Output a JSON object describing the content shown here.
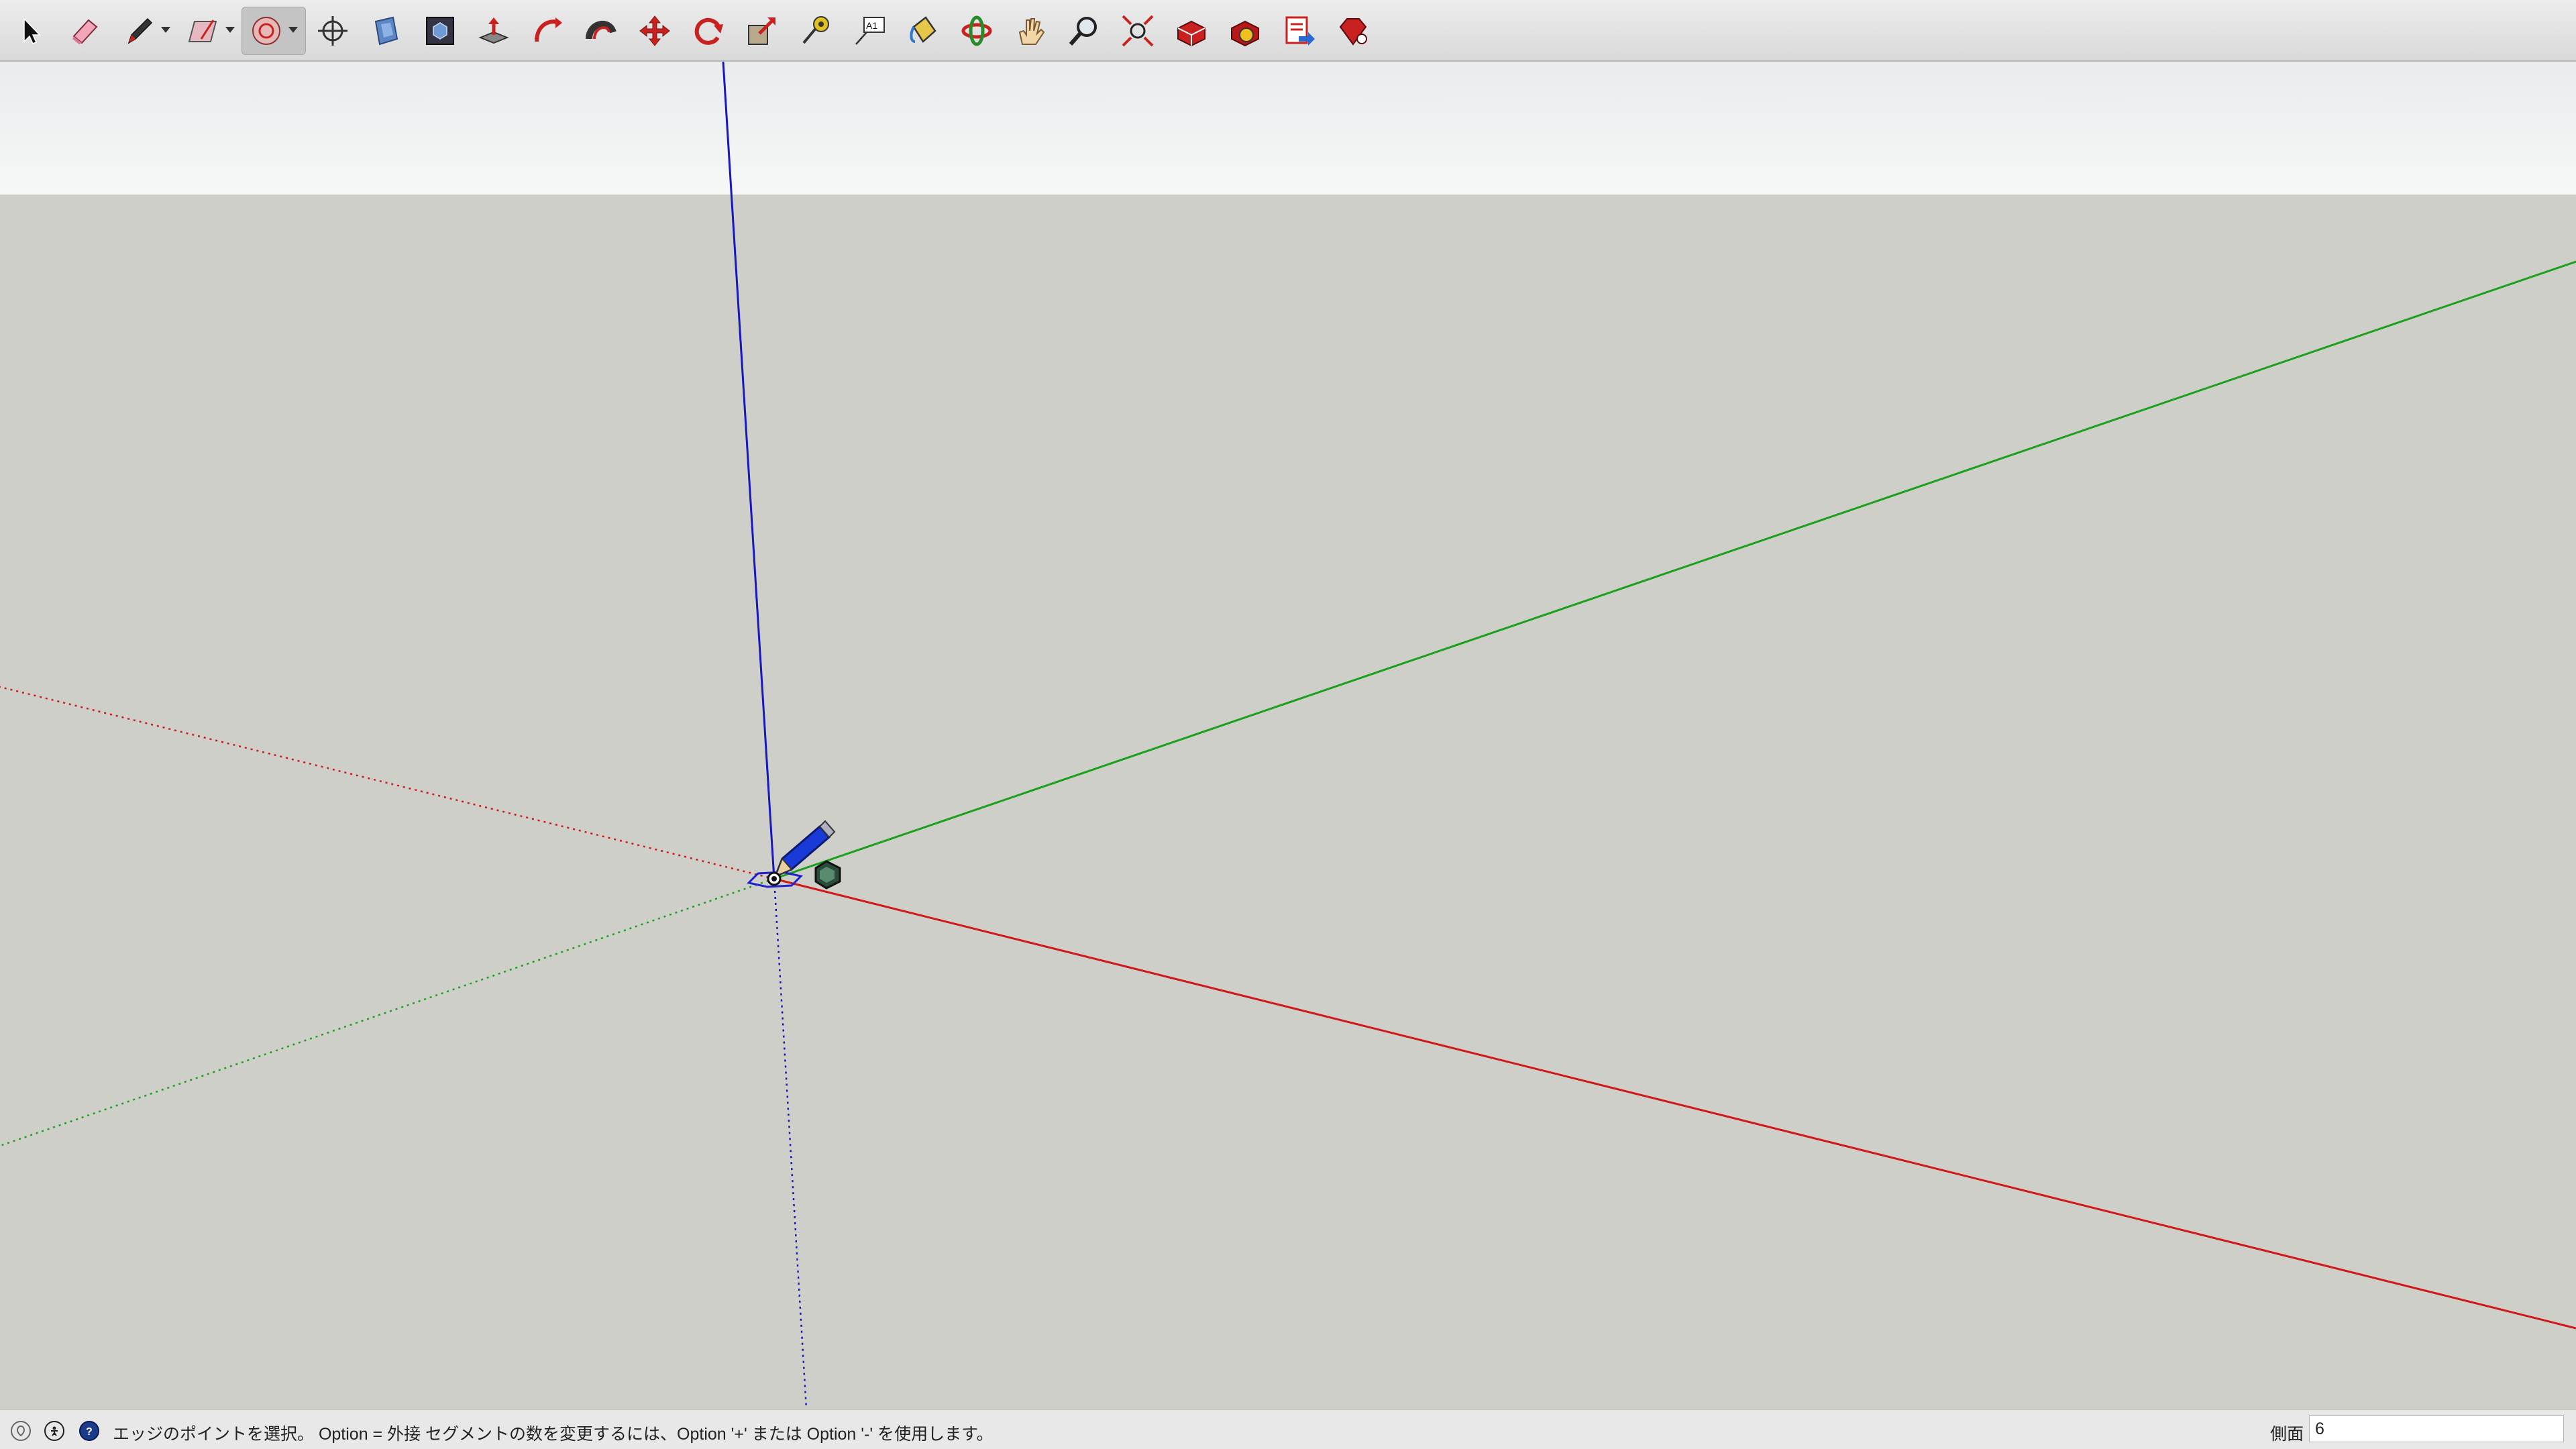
{
  "toolbar": {
    "tools": [
      {
        "name": "select-tool",
        "icon": "arrow-cursor-icon"
      },
      {
        "name": "eraser-tool",
        "icon": "eraser-icon"
      },
      {
        "name": "line-tool",
        "icon": "pencil-icon",
        "has_dropdown": true
      },
      {
        "name": "rectangle-tool",
        "icon": "rectangle-icon",
        "has_dropdown": true
      },
      {
        "name": "polygon-tool",
        "icon": "polygon-icon",
        "has_dropdown": true,
        "active": true
      },
      {
        "name": "orbit-center-tool",
        "icon": "crosshair-icon"
      },
      {
        "name": "component-tool",
        "icon": "component-icon"
      },
      {
        "name": "group-tool",
        "icon": "group-icon"
      },
      {
        "name": "push-pull-tool",
        "icon": "push-pull-icon"
      },
      {
        "name": "follow-me-tool",
        "icon": "follow-me-icon"
      },
      {
        "name": "offset-tool",
        "icon": "offset-icon"
      },
      {
        "name": "move-tool",
        "icon": "move-icon"
      },
      {
        "name": "rotate-tool",
        "icon": "rotate-icon"
      },
      {
        "name": "scale-tool",
        "icon": "scale-icon"
      },
      {
        "name": "tape-measure-tool",
        "icon": "tape-measure-icon"
      },
      {
        "name": "text-tool",
        "icon": "text-label-icon"
      },
      {
        "name": "paint-bucket-tool",
        "icon": "paint-bucket-icon"
      },
      {
        "name": "orbit-tool",
        "icon": "orbit-icon"
      },
      {
        "name": "pan-tool",
        "icon": "hand-icon"
      },
      {
        "name": "zoom-tool",
        "icon": "magnifier-icon"
      },
      {
        "name": "zoom-extents-tool",
        "icon": "zoom-extents-icon"
      },
      {
        "name": "warehouse-tool",
        "icon": "warehouse-icon"
      },
      {
        "name": "extension-warehouse-tool",
        "icon": "extension-warehouse-icon"
      },
      {
        "name": "send-to-layout-tool",
        "icon": "layout-icon"
      },
      {
        "name": "extension-manager-tool",
        "icon": "ruby-gem-icon"
      }
    ],
    "text_tool_glyph": "A1"
  },
  "colors": {
    "x_axis": "#d01818",
    "y_axis": "#1aa01a",
    "z_axis": "#1818c0",
    "ground": "#cfcfca",
    "sky": "#eef0f0",
    "toolbar": "#e2e2e2"
  },
  "status": {
    "message": "エッジのポイントを選択。 Option = 外接 セグメントの数を変更するには、Option '+' または Option '-' を使用します。",
    "measure_label": "側面",
    "measure_value": "6",
    "icons": [
      "geo-location-icon",
      "credits-icon",
      "help-icon"
    ]
  }
}
